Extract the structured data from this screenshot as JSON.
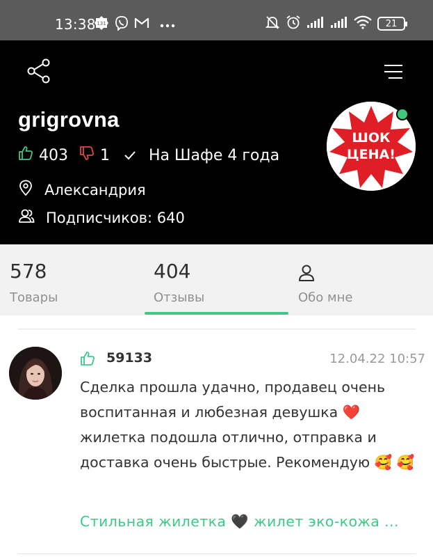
{
  "status_bar": {
    "time": "13:38",
    "notif_badge": "131",
    "battery": "21",
    "icons": [
      "notification-badge-icon",
      "viber-icon",
      "gmail-icon",
      "more-dots-icon",
      "mute-bell-icon",
      "alarm-icon",
      "signal-icon",
      "signal-icon",
      "wifi-icon",
      "battery-icon"
    ]
  },
  "profile": {
    "username": "grigrovna",
    "likes": "403",
    "dislikes": "1",
    "on_shafa": "На Шафе 4 года",
    "city": "Александрия",
    "subscribers": "Подписчиков: 640",
    "avatar_text_line1": "ШОК",
    "avatar_text_line2": "ЦЕНА!",
    "online": true
  },
  "tabs": [
    {
      "count": "578",
      "label": "Товары",
      "active": false
    },
    {
      "count": "404",
      "label": "Отзывы",
      "active": true
    },
    {
      "count": "",
      "label": "Обо мне",
      "active": false,
      "icon": "user-icon"
    }
  ],
  "review": {
    "score": "59133",
    "date": "12.04.22 10:57",
    "text": "Сделка прошла удачно, продавец очень воспитанная и любезная девушка ❤️ жилетка подошла отлично, отправка и доставка очень быстрые. Рекомендую 🥰 🥰",
    "products": "Стильная жилетка 🖤 жилет эко-кожа ..."
  },
  "colors": {
    "accent": "#3ec98a",
    "dislike": "#e0454a",
    "header_bg": "#000000",
    "tabs_bg": "#f2f2f2"
  }
}
